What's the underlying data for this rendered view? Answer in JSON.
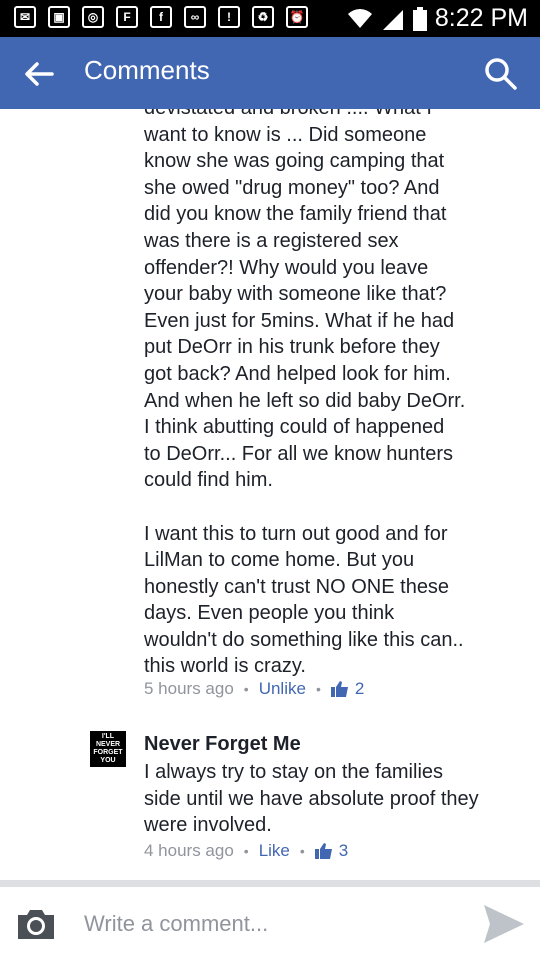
{
  "statusbar": {
    "time": "8:22 PM"
  },
  "appbar": {
    "title": "Comments"
  },
  "comment1": {
    "text_lines": [
      "devistated and broken .... What I",
      "want to know is ... Did someone",
      "know she was going camping that",
      "she owed \"drug money\" too? And",
      "did you know the family friend that",
      "was there is a registered sex",
      "offender?! Why would you leave",
      "your baby with someone like that?",
      "Even just for 5mins. What if he had",
      "put DeOrr in his trunk before they",
      "got back? And helped look for him.",
      "And when he left so did baby DeOrr.",
      "I think abutting could of happened",
      "to DeOrr... For all we know hunters",
      "could find him.",
      "",
      "I want this to turn out good and for",
      "LilMan to come home. But you",
      "honestly can't trust NO ONE these",
      "days. Even people you think",
      "wouldn't do something like this can..",
      "this world is crazy."
    ],
    "time": "5 hours ago",
    "action": "Unlike",
    "likes": "2"
  },
  "comment2": {
    "avatar_text": "I'LL NEVER FORGET YOU",
    "author": "Never Forget Me",
    "text": "I always try to stay on the families side until we have absolute proof they were involved.",
    "time": "4 hours ago",
    "action": "Like",
    "likes": "3"
  },
  "composer": {
    "placeholder": "Write a comment..."
  },
  "colors": {
    "brand": "#4267b2",
    "meta": "#90949c",
    "text": "#1d2129"
  }
}
